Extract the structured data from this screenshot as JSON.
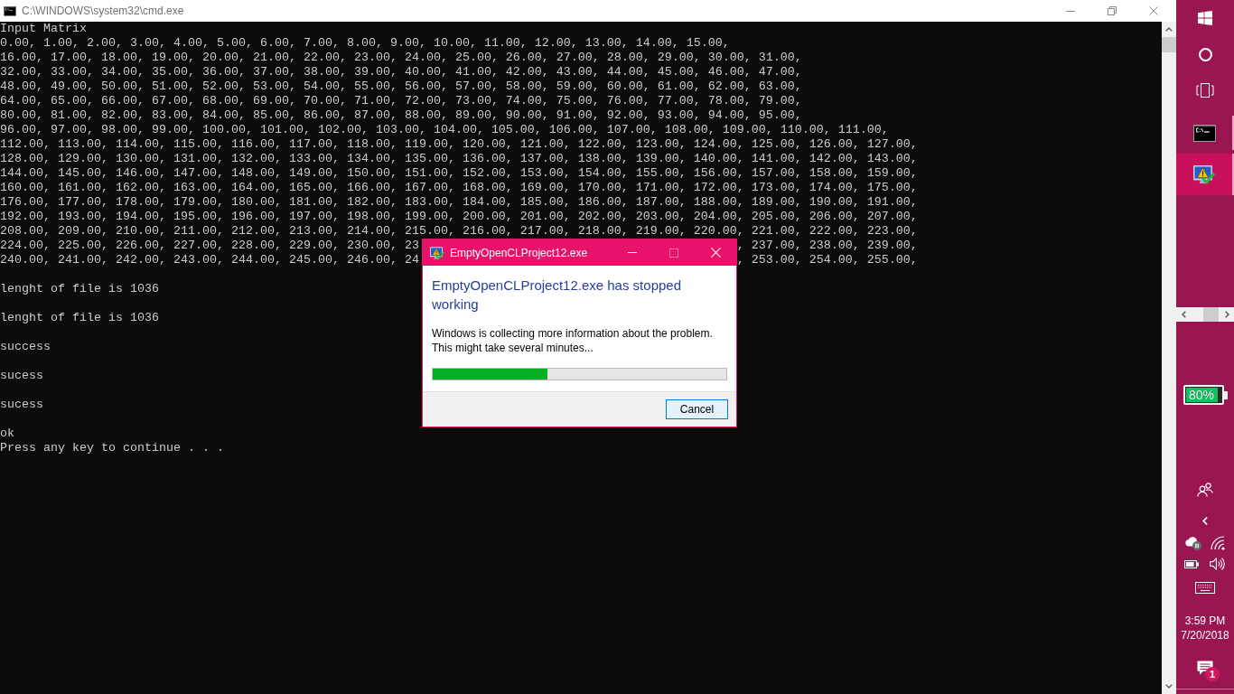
{
  "console_window": {
    "title": "C:\\WINDOWS\\system32\\cmd.exe",
    "lines": [
      {
        "kind": "text",
        "text": "Input Matrix"
      },
      {
        "kind": "text",
        "text": "0.00, 1.00, 2.00, 3.00, 4.00, 5.00, 6.00, 7.00, 8.00, 9.00, 10.00, 11.00, 12.00, 13.00, 14.00, 15.00,"
      },
      {
        "kind": "text",
        "text": "16.00, 17.00, 18.00, 19.00, 20.00, 21.00, 22.00, 23.00, 24.00, 25.00, 26.00, 27.00, 28.00, 29.00, 30.00, 31.00,"
      },
      {
        "kind": "text",
        "text": "32.00, 33.00, 34.00, 35.00, 36.00, 37.00, 38.00, 39.00, 40.00, 41.00, 42.00, 43.00, 44.00, 45.00, 46.00, 47.00,"
      },
      {
        "kind": "text",
        "text": "48.00, 49.00, 50.00, 51.00, 52.00, 53.00, 54.00, 55.00, 56.00, 57.00, 58.00, 59.00, 60.00, 61.00, 62.00, 63.00,"
      },
      {
        "kind": "text",
        "text": "64.00, 65.00, 66.00, 67.00, 68.00, 69.00, 70.00, 71.00, 72.00, 73.00, 74.00, 75.00, 76.00, 77.00, 78.00, 79.00,"
      },
      {
        "kind": "text",
        "text": "80.00, 81.00, 82.00, 83.00, 84.00, 85.00, 86.00, 87.00, 88.00, 89.00, 90.00, 91.00, 92.00, 93.00, 94.00, 95.00,"
      },
      {
        "kind": "text",
        "text": "96.00, 97.00, 98.00, 99.00, 100.00, 101.00, 102.00, 103.00, 104.00, 105.00, 106.00, 107.00, 108.00, 109.00, 110.00, 111.00,"
      },
      {
        "kind": "text",
        "text": "112.00, 113.00, 114.00, 115.00, 116.00, 117.00, 118.00, 119.00, 120.00, 121.00, 122.00, 123.00, 124.00, 125.00, 126.00, 127.00,"
      },
      {
        "kind": "text",
        "text": "128.00, 129.00, 130.00, 131.00, 132.00, 133.00, 134.00, 135.00, 136.00, 137.00, 138.00, 139.00, 140.00, 141.00, 142.00, 143.00,"
      },
      {
        "kind": "text",
        "text": "144.00, 145.00, 146.00, 147.00, 148.00, 149.00, 150.00, 151.00, 152.00, 153.00, 154.00, 155.00, 156.00, 157.00, 158.00, 159.00,"
      },
      {
        "kind": "text",
        "text": "160.00, 161.00, 162.00, 163.00, 164.00, 165.00, 166.00, 167.00, 168.00, 169.00, 170.00, 171.00, 172.00, 173.00, 174.00, 175.00,"
      },
      {
        "kind": "text",
        "text": "176.00, 177.00, 178.00, 179.00, 180.00, 181.00, 182.00, 183.00, 184.00, 185.00, 186.00, 187.00, 188.00, 189.00, 190.00, 191.00,"
      },
      {
        "kind": "text",
        "text": "192.00, 193.00, 194.00, 195.00, 196.00, 197.00, 198.00, 199.00, 200.00, 201.00, 202.00, 203.00, 204.00, 205.00, 206.00, 207.00,"
      },
      {
        "kind": "text",
        "text": "208.00, 209.00, 210.00, 211.00, 212.00, 213.00, 214.00, 215.00, 216.00, 217.00, 218.00, 219.00, 220.00, 221.00, 222.00, 223.00,"
      },
      {
        "kind": "split",
        "text": "224.00, 225.00, 226.00, 227.00, 228.00, 229.00, 230.00, 23",
        "text_right": ", 237.00, 238.00, 239.00,"
      },
      {
        "kind": "split",
        "text": "240.00, 241.00, 242.00, 243.00, 244.00, 245.00, 246.00, 24",
        "text_right": ", 253.00, 254.00, 255.00,"
      },
      {
        "kind": "blank"
      },
      {
        "kind": "text",
        "text": "lenght of file is 1036"
      },
      {
        "kind": "blank"
      },
      {
        "kind": "text",
        "text": "lenght of file is 1036"
      },
      {
        "kind": "blank"
      },
      {
        "kind": "text",
        "text": "success"
      },
      {
        "kind": "blank"
      },
      {
        "kind": "text",
        "text": "sucess"
      },
      {
        "kind": "blank"
      },
      {
        "kind": "text",
        "text": "sucess"
      },
      {
        "kind": "blank"
      },
      {
        "kind": "text",
        "text": "ok"
      },
      {
        "kind": "text",
        "text": "Press any key to continue . . ."
      }
    ]
  },
  "dialog": {
    "title": "EmptyOpenCLProject12.exe",
    "window_buttons": [
      {
        "kind": "minimize",
        "disabled": false
      },
      {
        "kind": "maximize",
        "disabled": true
      },
      {
        "kind": "close",
        "disabled": false
      }
    ],
    "heading": "EmptyOpenCLProject12.exe has stopped working",
    "message": "Windows is collecting more information about the problem. This might take several minutes...",
    "progress": {
      "level": 0.39
    },
    "buttons": [
      {
        "label": "Cancel",
        "focused": true
      }
    ]
  },
  "taskbar": {
    "apps": [
      {
        "kind": "console",
        "selected": false,
        "running": true
      },
      {
        "kind": "error-report",
        "selected": true,
        "running": true
      }
    ],
    "battery_meter": {
      "label": "80%"
    },
    "clock": {
      "time": "3:59 PM",
      "date": "7/20/2018"
    },
    "notifications": {
      "count": "1"
    }
  }
}
